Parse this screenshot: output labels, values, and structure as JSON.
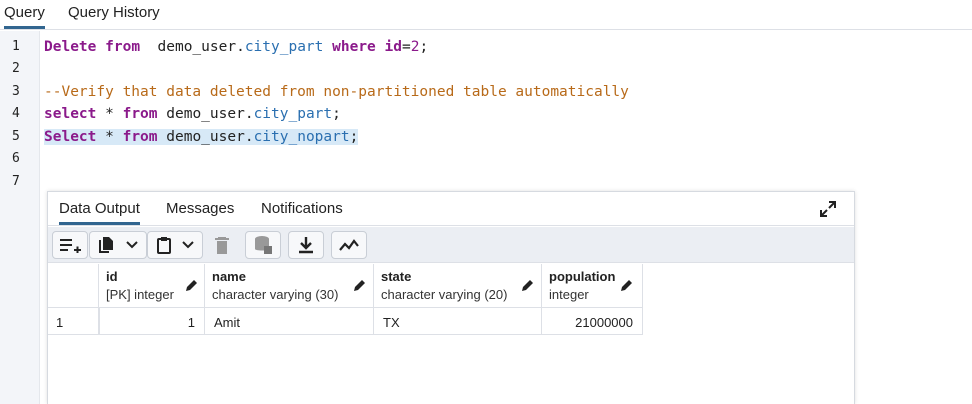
{
  "top_tabs": [
    {
      "label": "Query",
      "active": true
    },
    {
      "label": "Query History",
      "active": false
    }
  ],
  "editor": {
    "line_numbers": [
      "1",
      "2",
      "3",
      "4",
      "5",
      "6",
      "7"
    ],
    "line1": {
      "kw1": "Delete",
      "kw2": "from",
      "schema": "demo_user.",
      "table": "city_part",
      "kw3": "where",
      "col": "id",
      "eq": "=",
      "num": "2",
      "end": ";"
    },
    "line3": {
      "comment": "--Verify that data deleted from non-partitioned table automatically"
    },
    "line4": {
      "kw1": "select",
      "star": "*",
      "kw2": "from",
      "schema": "demo_user.",
      "table": "city_part",
      "end": ";"
    },
    "line5": {
      "kw1": "Select",
      "star": "*",
      "kw2": "from",
      "schema": "demo_user.",
      "table": "city_nopart",
      "end": ";"
    }
  },
  "results": {
    "tabs": [
      {
        "label": "Data Output",
        "active": true
      },
      {
        "label": "Messages",
        "active": false
      },
      {
        "label": "Notifications",
        "active": false
      }
    ],
    "columns": [
      {
        "name": "id",
        "type": "[PK] integer"
      },
      {
        "name": "name",
        "type": "character varying (30)"
      },
      {
        "name": "state",
        "type": "character varying (20)"
      },
      {
        "name": "population",
        "type": "integer"
      }
    ],
    "rows": [
      {
        "row_number": "1",
        "id": "1",
        "name": "Amit",
        "state": "TX",
        "population": "21000000"
      }
    ]
  },
  "icons": {
    "toolbar": [
      "add-row-icon",
      "copy-icon",
      "chevron-down-icon",
      "paste-icon",
      "chevron-down-icon",
      "delete-icon",
      "save-data-icon",
      "download-icon",
      "graph-icon"
    ],
    "expand": "expand-icon",
    "edit": "pencil-icon"
  },
  "colors": {
    "accent": "#326690",
    "keyword": "#8b1a8b",
    "table_name": "#2a6fb0",
    "comment": "#b86a19",
    "selection": "#d7e9f7"
  }
}
